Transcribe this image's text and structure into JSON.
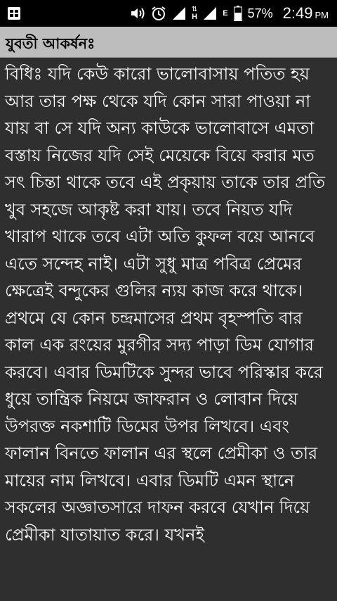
{
  "status_bar": {
    "left_icons": [
      "notification-icon"
    ],
    "right_icons": [
      "volume-icon",
      "alarm-icon",
      "signal-icon",
      "data-h-icon",
      "signal-icon-2",
      "data-e-icon",
      "battery-icon"
    ],
    "data_h_label": "H",
    "data_e_label": "E",
    "battery_percent": "57%",
    "time": "2:49",
    "ampm": "PM"
  },
  "header": {
    "title": "যুবতী আকর্ষনঃ"
  },
  "article": {
    "body": "বিধিঃ যদি কেউ কারো ভালোবাসায় পতিত হয় আর তার পক্ষ থেকে যদি কোন সারা পাওয়া না যায় বা সে যদি অন্য কাউকে ভালোবাসে এমতা বস্তায় নিজের যদি সেই মেয়েকে বিয়ে করার মত সৎ চিন্তা থাকে তবে এই প্রকৃয়ায় তাকে তার প্রতি খুব সহজে আকৃষ্ট করা যায়। তবে নিয়ত যদি খারাপ থাকে তবে এটা অতি কুফল বয়ে আনবে এতে সন্দেহ নাই। এটা সুধু মাত্র পবিত্র প্রেমের ক্ষেত্রেই বন্দুকের গুলির ন্যয় কাজ করে থাকে।প্রথমে যে কোন চন্দ্রমাসের প্রথম বৃহস্পতি বার কাল এক রংয়ের মুরগীর সদ্য পাড়া ডিম যোগার করবে। এবার ডিমটিকে সুন্দর ভাবে পরিস্কার করে ধুয়ে তান্ত্রিক নিয়মে জাফরান ও লোবান দিয়ে উপরক্ত নকশাটি ডিমের উপর লিখবে। এবং ফালান বিনতে ফালান এর স্থলে প্রেমীকা ও তার মায়ের নাম লিখবে। এবার ডিমটি এমন স্থানে সকলের অজ্ঞাতসারে দাফন করবে যেখান দিয়ে প্রেমীকা যাতায়াত করে। যখনই"
  },
  "colors": {
    "status_bar_bg": "#000000",
    "title_bar_bg": "#bdbdbd",
    "content_bg": "#2f2f2f",
    "body_text": "#ffffff",
    "title_text": "#000000"
  }
}
